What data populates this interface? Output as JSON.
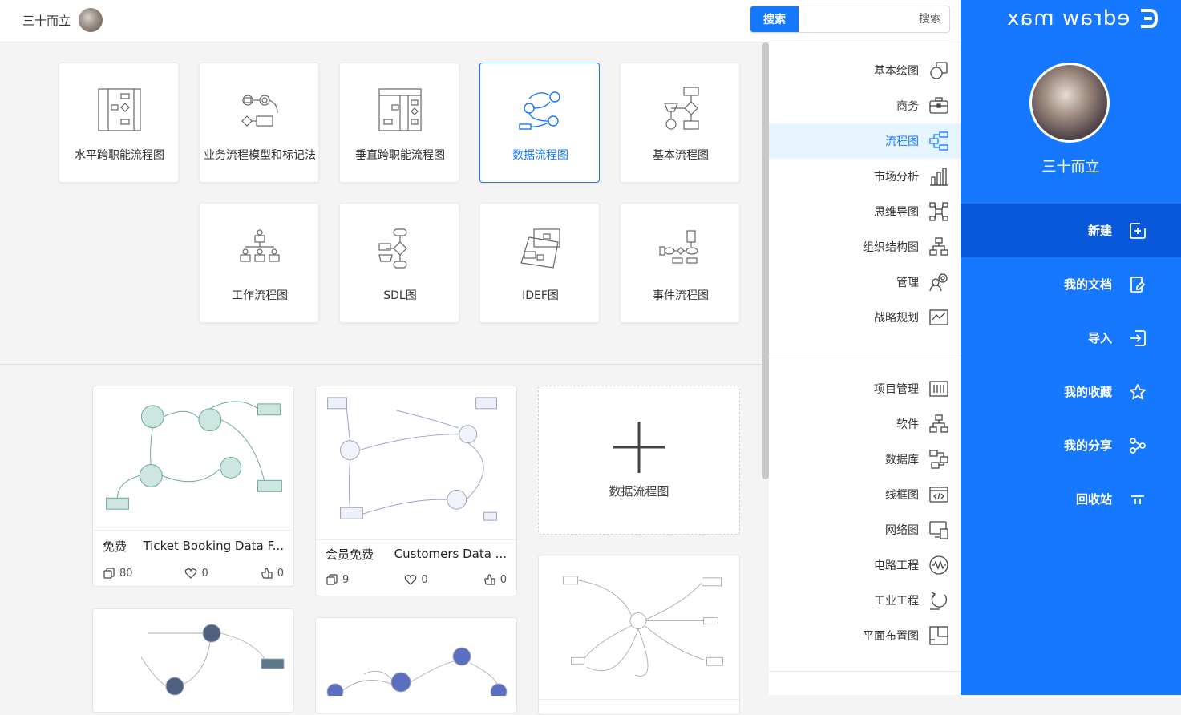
{
  "topbar": {
    "user_name": "三十而立",
    "search_button": "搜索",
    "search_placeholder": "搜索"
  },
  "sidebar": {
    "brand": "edraw max",
    "user_name": "三十而立",
    "nav": [
      {
        "label": "新建",
        "icon": "new-file-icon",
        "active": true
      },
      {
        "label": "我的文档",
        "icon": "document-icon"
      },
      {
        "label": "导入",
        "icon": "import-icon"
      },
      {
        "label": "我的收藏",
        "icon": "star-icon"
      },
      {
        "label": "我的分享",
        "icon": "share-icon"
      },
      {
        "label": "回收站",
        "icon": "trash-icon"
      }
    ],
    "brand_color": "#1677ff"
  },
  "categories": {
    "group1": [
      {
        "label": "基本绘图",
        "icon": "shapes-icon"
      },
      {
        "label": "商务",
        "icon": "briefcase-icon"
      },
      {
        "label": "流程图",
        "icon": "flowchart-icon",
        "active": true
      },
      {
        "label": "市场分析",
        "icon": "bar-chart-icon"
      },
      {
        "label": "思维导图",
        "icon": "mindmap-icon"
      },
      {
        "label": "组织结构图",
        "icon": "org-chart-icon"
      },
      {
        "label": "管理",
        "icon": "management-icon"
      },
      {
        "label": "战略规划",
        "icon": "strategy-icon"
      }
    ],
    "group2": [
      {
        "label": "项目管理",
        "icon": "project-icon"
      },
      {
        "label": "软件",
        "icon": "software-icon"
      },
      {
        "label": "数据库",
        "icon": "database-icon"
      },
      {
        "label": "线框图",
        "icon": "wireframe-icon"
      },
      {
        "label": "网络图",
        "icon": "network-icon"
      },
      {
        "label": "电路工程",
        "icon": "circuit-icon"
      },
      {
        "label": "工业工程",
        "icon": "industrial-icon"
      },
      {
        "label": "平面布置图",
        "icon": "floorplan-icon"
      }
    ]
  },
  "templates": [
    {
      "label": "基本流程图",
      "icon": "basic-flowchart-icon"
    },
    {
      "label": "数据流程图",
      "icon": "data-flow-icon",
      "selected": true
    },
    {
      "label": "垂直跨职能流程图",
      "icon": "vertical-swimlane-icon"
    },
    {
      "label": "业务流程模型和标记法",
      "icon": "bpmn-icon"
    },
    {
      "label": "水平跨职能流程图",
      "icon": "horizontal-swimlane-icon"
    },
    {
      "label": "事件流程图",
      "icon": "event-flow-icon"
    },
    {
      "label": "IDEF图",
      "icon": "idef-icon"
    },
    {
      "label": "SDL图",
      "icon": "sdl-icon"
    },
    {
      "label": "工作流程图",
      "icon": "workflow-icon"
    }
  ],
  "new_blank": {
    "label": "数据流程图"
  },
  "examples": [
    {
      "title": "Customers Data ...",
      "badge": "会员免费",
      "likes": "0",
      "favorites": "0",
      "copies": "9"
    },
    {
      "title": "Ticket Booking Data F...",
      "badge": "免费",
      "likes": "0",
      "favorites": "0",
      "copies": "80"
    }
  ]
}
